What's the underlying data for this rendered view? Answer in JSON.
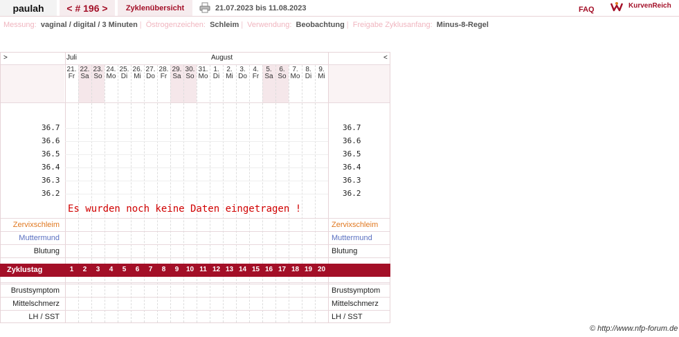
{
  "header": {
    "user": "paulah",
    "cycle_nav": "< # 196 >",
    "overview": "Zyklenübersicht",
    "date_range": "21.07.2023 bis 11.08.2023",
    "faq": "FAQ",
    "brand": "KurvenReich"
  },
  "meta": [
    {
      "key": "Messung:",
      "value": "vaginal / digital / 3 Minuten"
    },
    {
      "key": "Östrogenzeichen:",
      "value": "Schleim"
    },
    {
      "key": "Verwendung:",
      "value": "Beobachtung"
    },
    {
      "key": "Freigabe Zyklusanfang:",
      "value": "Minus-8-Regel"
    }
  ],
  "nav": {
    "prev": ">",
    "next": "<",
    "month1": "Juli",
    "month2": "August"
  },
  "days": [
    {
      "d": "21.",
      "w": "Fr",
      "we": false
    },
    {
      "d": "22.",
      "w": "Sa",
      "we": true
    },
    {
      "d": "23.",
      "w": "So",
      "we": true
    },
    {
      "d": "24.",
      "w": "Mo",
      "we": false
    },
    {
      "d": "25.",
      "w": "Di",
      "we": false
    },
    {
      "d": "26.",
      "w": "Mi",
      "we": false
    },
    {
      "d": "27.",
      "w": "Do",
      "we": false
    },
    {
      "d": "28.",
      "w": "Fr",
      "we": false
    },
    {
      "d": "29.",
      "w": "Sa",
      "we": true
    },
    {
      "d": "30.",
      "w": "So",
      "we": true
    },
    {
      "d": "31.",
      "w": "Mo",
      "we": false
    },
    {
      "d": "1.",
      "w": "Di",
      "we": false
    },
    {
      "d": "2.",
      "w": "Mi",
      "we": false
    },
    {
      "d": "3.",
      "w": "Do",
      "we": false
    },
    {
      "d": "4.",
      "w": "Fr",
      "we": false
    },
    {
      "d": "5.",
      "w": "Sa",
      "we": true
    },
    {
      "d": "6.",
      "w": "So",
      "we": true
    },
    {
      "d": "7.",
      "w": "Mo",
      "we": false
    },
    {
      "d": "8.",
      "w": "Di",
      "we": false
    },
    {
      "d": "9.",
      "w": "Mi",
      "we": false
    }
  ],
  "temperatures": [
    "36.7",
    "36.6",
    "36.5",
    "36.4",
    "36.3",
    "36.2"
  ],
  "no_data": "Es wurden noch keine Daten eingetragen !",
  "rows": {
    "zervix": "Zervixschleim",
    "muttermund": "Muttermund",
    "blutung": "Blutung",
    "zyklustag": "Zyklustag",
    "brust": "Brustsymptom",
    "mittel": "Mittelschmerz",
    "lh": "LH / SST"
  },
  "zyklustage": [
    "1",
    "2",
    "3",
    "4",
    "5",
    "6",
    "7",
    "8",
    "9",
    "10",
    "11",
    "12",
    "13",
    "14",
    "15",
    "16",
    "17",
    "18",
    "19",
    "20"
  ],
  "colors": {
    "accent": "#a30f27",
    "zervix": "#e07820",
    "muttermund": "#5a6fc0"
  },
  "footer": "© http://www.nfp-forum.de"
}
